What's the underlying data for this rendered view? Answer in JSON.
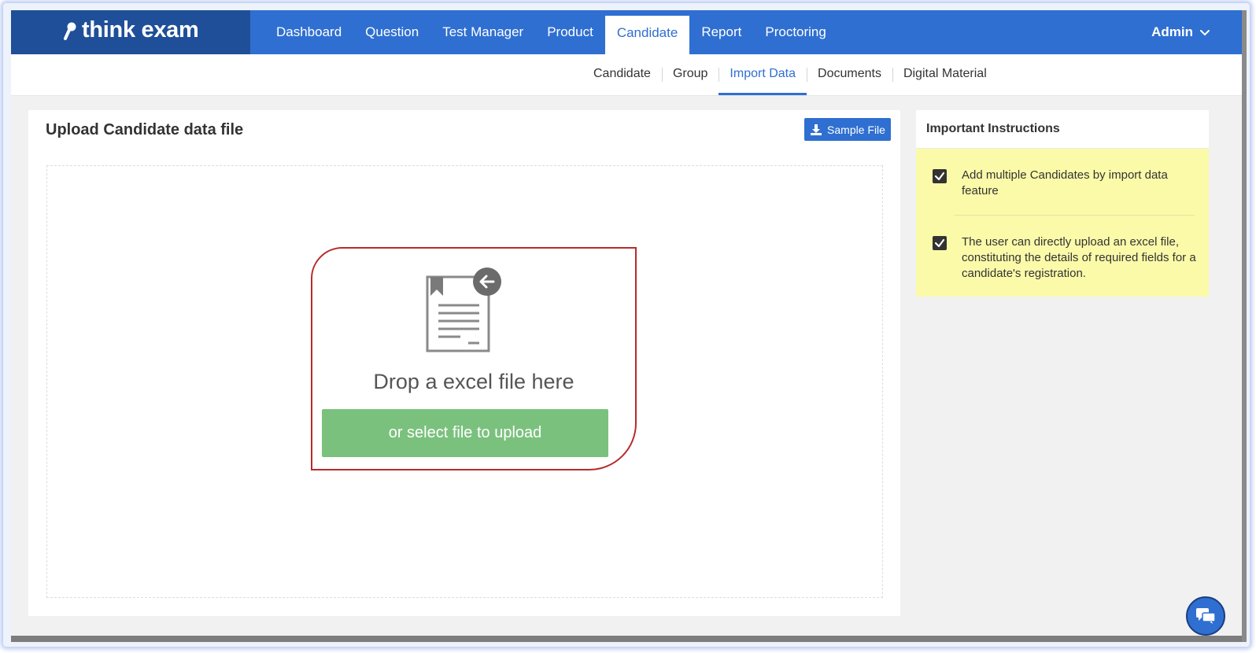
{
  "brand": {
    "name": "think exam"
  },
  "topnav": {
    "items": [
      {
        "label": "Dashboard"
      },
      {
        "label": "Question"
      },
      {
        "label": "Test Manager"
      },
      {
        "label": "Product"
      },
      {
        "label": "Candidate",
        "active": true
      },
      {
        "label": "Report"
      },
      {
        "label": "Proctoring"
      }
    ],
    "user_label": "Admin"
  },
  "subnav": {
    "items": [
      {
        "label": "Candidate"
      },
      {
        "label": "Group"
      },
      {
        "label": "Import Data",
        "active": true
      },
      {
        "label": "Documents"
      },
      {
        "label": "Digital Material"
      }
    ]
  },
  "upload": {
    "title": "Upload Candidate data file",
    "sample_button": "Sample File",
    "drop_text": "Drop a excel file here",
    "select_button": "or select file to upload"
  },
  "instructions": {
    "title": "Important Instructions",
    "items": [
      {
        "text": "Add multiple Candidates by import data feature",
        "checked": true
      },
      {
        "text": "The user can directly upload an excel file, constituting the details of required fields for a candidate's registration.",
        "checked": true
      }
    ]
  },
  "colors": {
    "primary": "#2f6fd1",
    "logo_bg": "#1f4f98",
    "upload_button": "#7bc17e",
    "highlight_border": "#b82b2b",
    "instructions_bg": "#fbfaa9"
  },
  "icons": {
    "logo": "think-exam-logo-icon",
    "download": "download-icon",
    "document": "document-icon",
    "arrow": "arrow-left-icon",
    "checkbox": "checkbox-checked-icon",
    "chevron": "chevron-down-icon",
    "chat": "chat-icon"
  }
}
